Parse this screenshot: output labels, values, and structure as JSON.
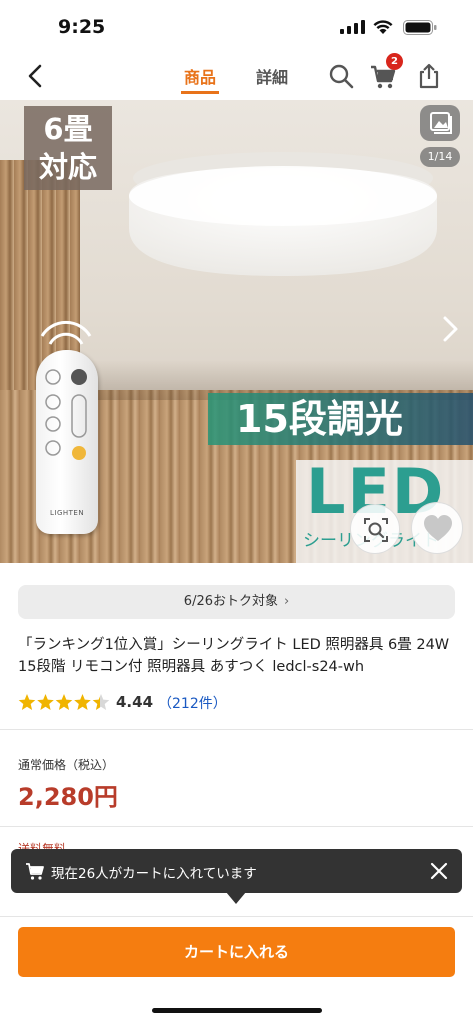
{
  "status_bar": {
    "time": "9:25"
  },
  "nav": {
    "tabs": [
      {
        "label": "商品",
        "active": true
      },
      {
        "label": "詳細",
        "active": false
      }
    ],
    "cart_count": "2"
  },
  "hero": {
    "badge_line1": "6畳",
    "badge_line2": "対応",
    "counter": "1/14",
    "band_text": "15段調光",
    "led_text": "LED",
    "led_sub": "シーリングライト",
    "remote_brand": "LIGHTEN"
  },
  "promo": {
    "label": "6/26おトク対象"
  },
  "product": {
    "title": "「ランキング1位入賞」シーリングライト LED 照明器具 6畳 24W 15段階 リモコン付 照明器具 あすつく ledcl-s24-wh",
    "rating": 4.44,
    "rating_text": "4.44",
    "reviews": "（212件）"
  },
  "price": {
    "label": "通常価格（税込）",
    "value": "2,280円"
  },
  "shipping_label": "送料無料",
  "toast": {
    "message": "現在26人がカートに入れています"
  },
  "cta": {
    "label": "カートに入れる"
  },
  "colors": {
    "accent": "#f57d10",
    "price": "#b83c2a",
    "link": "#1a59c2",
    "star": "#f0b400"
  }
}
